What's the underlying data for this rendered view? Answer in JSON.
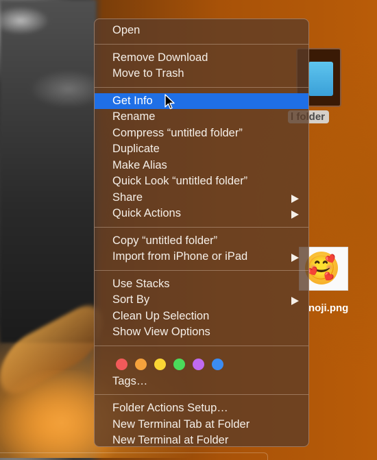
{
  "desktop": {
    "folder_label": "l folder",
    "emoji_file_label": "noji.png",
    "emoji_glyph": "🥰"
  },
  "menu": {
    "sections": [
      {
        "items": [
          {
            "label": "Open"
          }
        ]
      },
      {
        "items": [
          {
            "label": "Remove Download"
          },
          {
            "label": "Move to Trash"
          }
        ]
      },
      {
        "items": [
          {
            "label": "Get Info",
            "highlighted": true
          },
          {
            "label": "Rename"
          },
          {
            "label": "Compress “untitled folder”"
          },
          {
            "label": "Duplicate"
          },
          {
            "label": "Make Alias"
          },
          {
            "label": "Quick Look “untitled folder”"
          },
          {
            "label": "Share",
            "submenu": true
          },
          {
            "label": "Quick Actions",
            "submenu": true
          }
        ]
      },
      {
        "items": [
          {
            "label": "Copy “untitled folder”"
          },
          {
            "label": "Import from iPhone or iPad",
            "submenu": true
          }
        ]
      },
      {
        "items": [
          {
            "label": "Use Stacks"
          },
          {
            "label": "Sort By",
            "submenu": true
          },
          {
            "label": "Clean Up Selection"
          },
          {
            "label": "Show View Options"
          }
        ]
      },
      {
        "tags": [
          {
            "name": "red",
            "color": "#f25a5a"
          },
          {
            "name": "orange",
            "color": "#f5a23c"
          },
          {
            "name": "yellow",
            "color": "#fad634"
          },
          {
            "name": "green",
            "color": "#4bdb5a"
          },
          {
            "name": "purple",
            "color": "#c06af0"
          },
          {
            "name": "blue",
            "color": "#3b8cf2"
          }
        ],
        "items": [
          {
            "label": "Tags…"
          }
        ]
      },
      {
        "items": [
          {
            "label": "Folder Actions Setup…"
          },
          {
            "label": "New Terminal Tab at Folder"
          },
          {
            "label": "New Terminal at Folder"
          }
        ]
      }
    ]
  },
  "colors": {
    "highlight": "#1f6fe6"
  }
}
